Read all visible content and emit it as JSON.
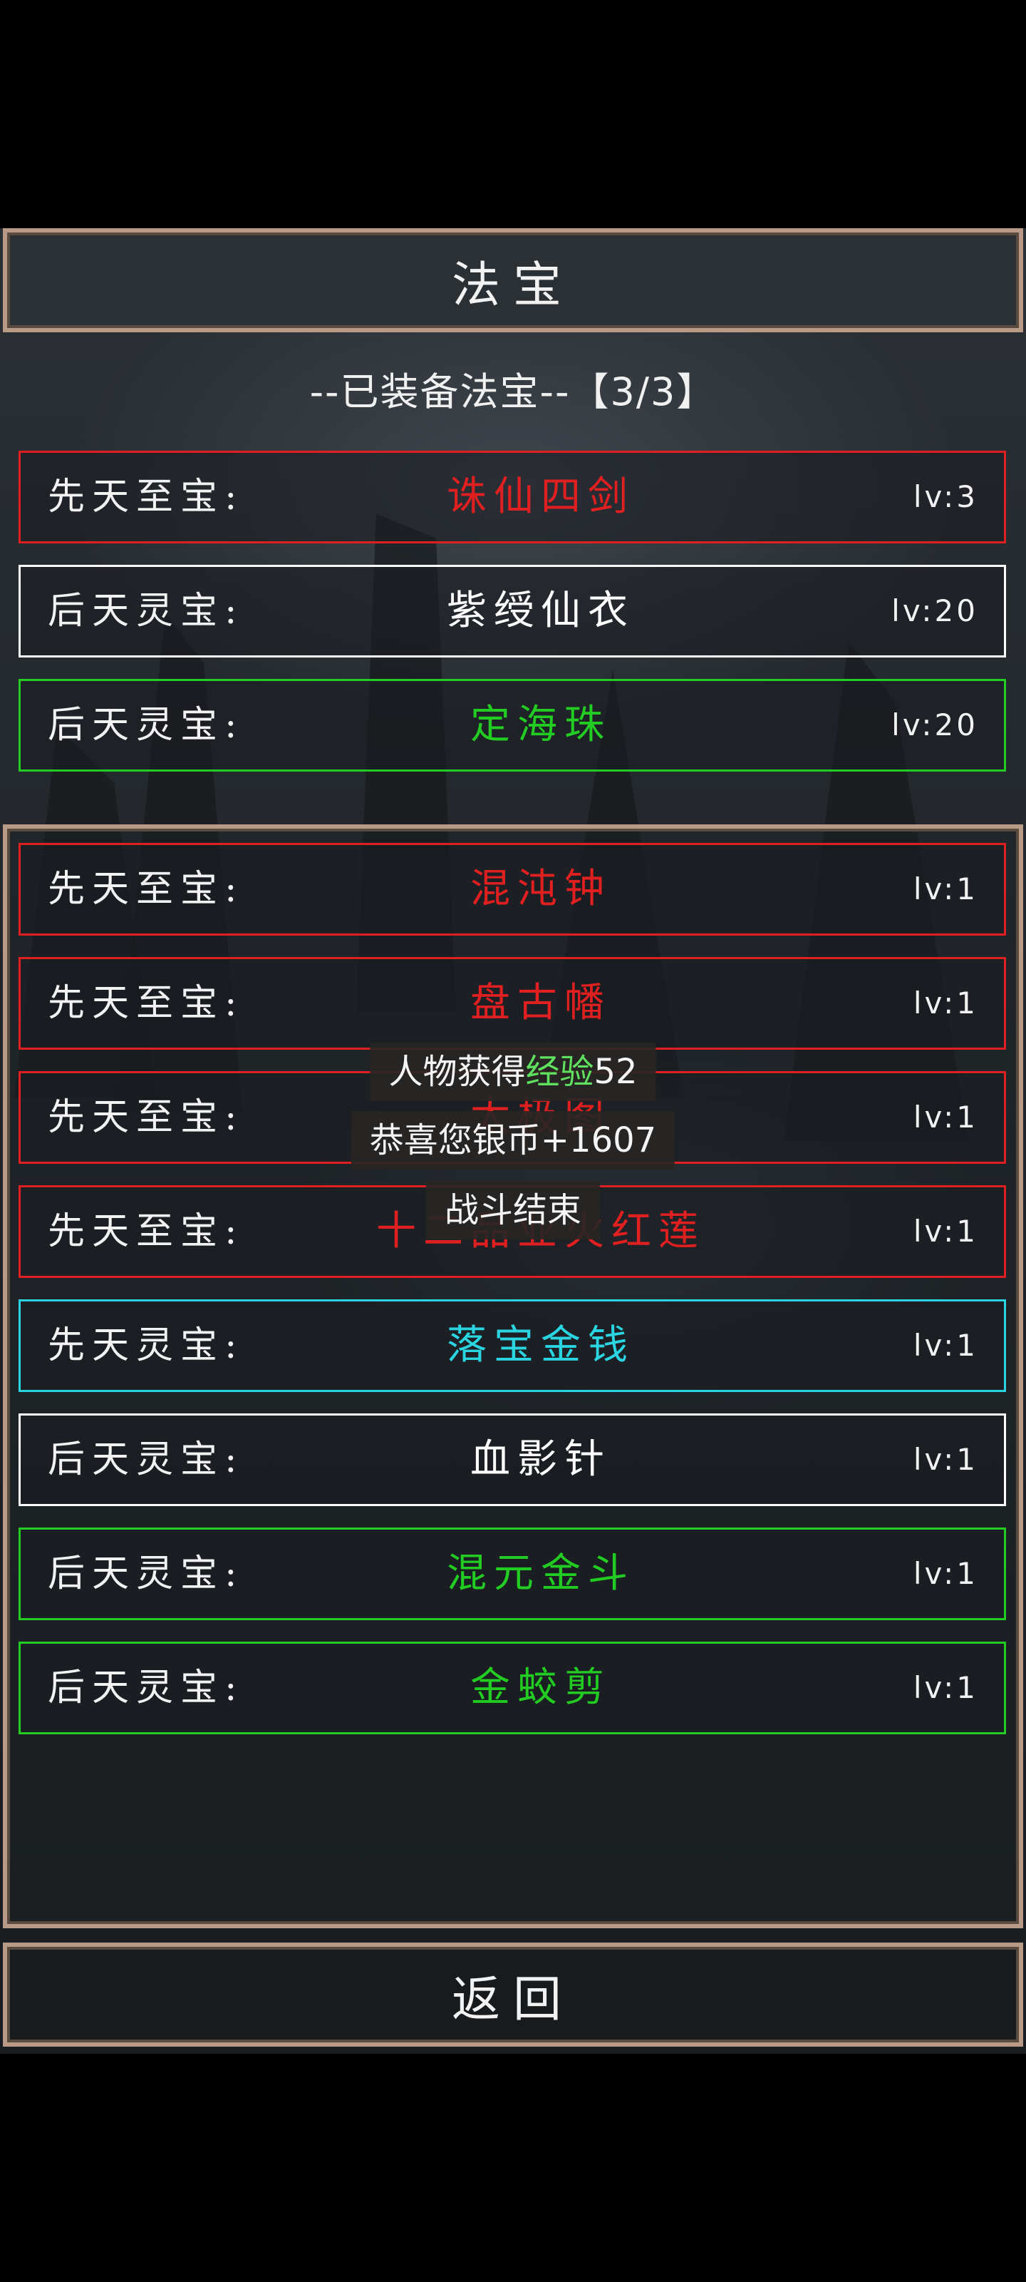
{
  "title": "法宝",
  "equipped_header": "--已装备法宝--【3/3】",
  "equipped": [
    {
      "kind": "先天至宝:",
      "name": "诛仙四剑",
      "level": "lv:3",
      "color": "#e02020"
    },
    {
      "kind": "后天灵宝:",
      "name": "紫绶仙衣",
      "level": "lv:20",
      "color": "#ffffff"
    },
    {
      "kind": "后天灵宝:",
      "name": "定海珠",
      "level": "lv:20",
      "color": "#22cc22"
    }
  ],
  "inventory": [
    {
      "kind": "先天至宝:",
      "name": "混沌钟",
      "level": "lv:1",
      "color": "#e02020"
    },
    {
      "kind": "先天至宝:",
      "name": "盘古幡",
      "level": "lv:1",
      "color": "#e02020"
    },
    {
      "kind": "先天至宝:",
      "name": "太极图",
      "level": "lv:1",
      "color": "#e02020"
    },
    {
      "kind": "先天至宝:",
      "name": "十二品业火红莲",
      "level": "lv:1",
      "color": "#e02020"
    },
    {
      "kind": "先天灵宝:",
      "name": "落宝金钱",
      "level": "lv:1",
      "color": "#2ad4e0"
    },
    {
      "kind": "后天灵宝:",
      "name": "血影针",
      "level": "lv:1",
      "color": "#ffffff"
    },
    {
      "kind": "后天灵宝:",
      "name": "混元金斗",
      "level": "lv:1",
      "color": "#22cc22"
    },
    {
      "kind": "后天灵宝:",
      "name": "金蛟剪",
      "level": "lv:1",
      "color": "#22cc22"
    }
  ],
  "toasts": {
    "exp_prefix": "人物获得",
    "exp_word": "经验",
    "exp_value": "52",
    "silver": "恭喜您银币+1607",
    "battle_end": "战斗结束"
  },
  "back_label": "返回"
}
